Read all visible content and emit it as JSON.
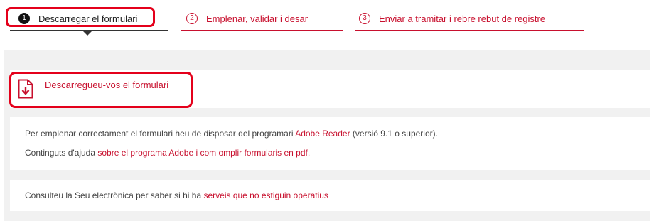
{
  "steps": [
    {
      "number": "1",
      "label": "Descarregar el formulari"
    },
    {
      "number": "2",
      "label": "Emplenar, validar i desar"
    },
    {
      "number": "3",
      "label": "Enviar a tramitar i rebre rebut de registre"
    }
  ],
  "download": {
    "icon": "pdf-download-icon",
    "link": "Descarregueu-vos el formulari"
  },
  "info": {
    "line1_pre": "Per emplenar correctament el formulari heu de disposar del programari ",
    "line1_link": "Adobe Reader",
    "line1_post": " (versió 9.1 o superior).",
    "line2_pre": "Continguts d'ajuda ",
    "line2_link": "sobre el programa Adobe i com omplir formularis en pdf."
  },
  "notice": {
    "pre": "Consulteu la Seu electrònica per saber si hi ha ",
    "link": "serveis que no estiguin operatius"
  },
  "colors": {
    "accent": "#c8102e",
    "highlight": "#e4001b",
    "panel": "#f1f1f1"
  }
}
